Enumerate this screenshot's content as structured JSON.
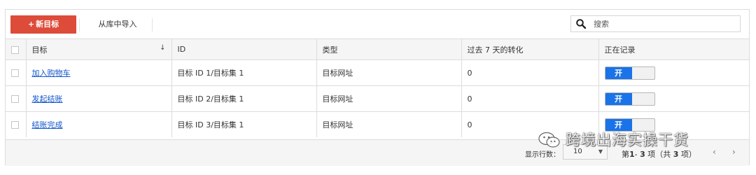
{
  "toolbar": {
    "new_goal_plus": "+",
    "new_goal_label": "新目标",
    "import_label": "从库中导入",
    "search_placeholder": "搜索"
  },
  "table": {
    "headers": {
      "goal": "目标",
      "sort_indicator": "↓",
      "id": "ID",
      "type": "类型",
      "conversions": "过去 7 天的转化",
      "recording": "正在记录"
    },
    "rows": [
      {
        "goal": "加入购物车",
        "id": "目标 ID 1/目标集 1",
        "type": "目标网址",
        "conversions": "0",
        "recording": "开",
        "recording_on": true
      },
      {
        "goal": "发起结账",
        "id": "目标 ID 2/目标集 1",
        "type": "目标网址",
        "conversions": "0",
        "recording": "开",
        "recording_on": true
      },
      {
        "goal": "结账完成",
        "id": "目标 ID 3/目标集 1",
        "type": "目标网址",
        "conversions": "0",
        "recording": "开",
        "recording_on": true
      }
    ]
  },
  "footer": {
    "rows_label": "显示行数：",
    "rows_value": "10",
    "range_prefix": "第",
    "range_from": "1",
    "range_sep": "- ",
    "range_to": "3",
    "range_mid": " 项（共 ",
    "range_total": "3",
    "range_suffix": " 项）",
    "prev_icon": "‹",
    "next_icon": "›"
  },
  "watermark": {
    "text": "跨境出海实操干货"
  },
  "colors": {
    "new_button": "#dd4b39",
    "toggle_on": "#1a73e8",
    "link": "#1155cc",
    "header_bg": "#f5f5f5"
  },
  "icons": {
    "search": "search-icon",
    "wechat": "wechat-icon"
  }
}
